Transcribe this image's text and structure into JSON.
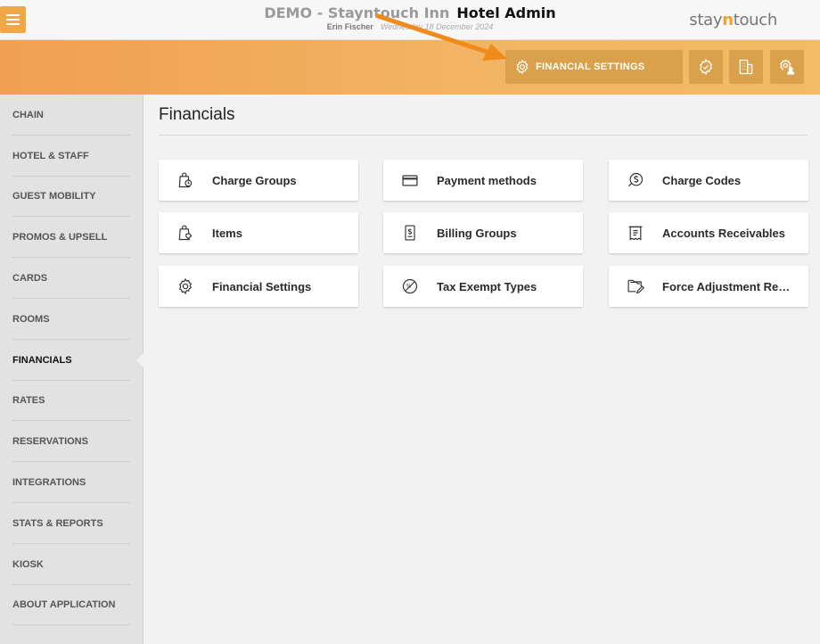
{
  "header": {
    "hotel_name": "DEMO - Stayntouch Inn",
    "app_name": "Hotel Admin",
    "user_name": "Erin Fischer",
    "date_text": "Wednesday 18 December 2024",
    "logo_prefix": "stay",
    "logo_accent": "n",
    "logo_suffix": "touch"
  },
  "actionbar": {
    "financial_settings_label": "FINANCIAL SETTINGS",
    "icons": [
      "gear-badge-icon",
      "building-icon",
      "user-settings-icon"
    ]
  },
  "sidebar": {
    "items": [
      {
        "label": "CHAIN"
      },
      {
        "label": "HOTEL & STAFF"
      },
      {
        "label": "GUEST MOBILITY"
      },
      {
        "label": "PROMOS & UPSELL"
      },
      {
        "label": "CARDS"
      },
      {
        "label": "ROOMS"
      },
      {
        "label": "FINANCIALS"
      },
      {
        "label": "RATES"
      },
      {
        "label": "RESERVATIONS"
      },
      {
        "label": "INTEGRATIONS"
      },
      {
        "label": "STATS & REPORTS"
      },
      {
        "label": "KIOSK"
      },
      {
        "label": "ABOUT APPLICATION"
      }
    ],
    "active": "FINANCIALS"
  },
  "main": {
    "title": "Financials",
    "cards": [
      {
        "label": "Charge Groups",
        "icon": "shopping-bag-clock-icon"
      },
      {
        "label": "Payment methods",
        "icon": "credit-card-icon"
      },
      {
        "label": "Charge Codes",
        "icon": "dollar-coin-icon"
      },
      {
        "label": "Items",
        "icon": "shopping-bag-tag-icon"
      },
      {
        "label": "Billing Groups",
        "icon": "dollar-document-icon"
      },
      {
        "label": "Accounts Receivables",
        "icon": "receipt-icon"
      },
      {
        "label": "Financial Settings",
        "icon": "gear-icon"
      },
      {
        "label": "Tax Exempt Types",
        "icon": "tax-exempt-icon"
      },
      {
        "label": "Force Adjustment Reasons",
        "icon": "folder-pencil-icon"
      }
    ]
  },
  "colors": {
    "accent": "#f0a847",
    "action_button": "#d9a14c",
    "annotation_arrow": "#f08a1a"
  }
}
